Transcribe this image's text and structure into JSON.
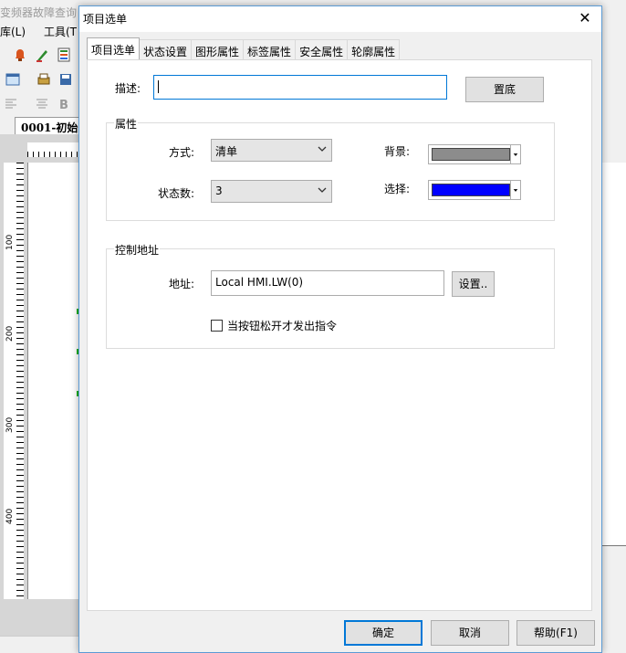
{
  "background_app": {
    "title": "变频器故障查询",
    "menu": {
      "lib": "库(L)",
      "tools": "工具(T"
    },
    "doc_tab": "0001-初始",
    "ruler_marks": [
      "100",
      "200",
      "300",
      "400"
    ]
  },
  "dialog": {
    "title": "项目选单",
    "close_glyph": "✕",
    "tabs": [
      "项目选单",
      "状态设置",
      "图形属性",
      "标签属性",
      "安全属性",
      "轮廓属性"
    ],
    "active_tab": 0,
    "description": {
      "label": "描述:",
      "value": ""
    },
    "bottom_button": "置底",
    "properties": {
      "group_label": "属性",
      "mode": {
        "label": "方式:",
        "value": "清单"
      },
      "states": {
        "label": "状态数:",
        "value": "3"
      },
      "background": {
        "label": "背景:",
        "color": "#8c8c8c"
      },
      "selection": {
        "label": "选择:",
        "color": "#0000ff"
      }
    },
    "control_address": {
      "group_label": "控制地址",
      "address": {
        "label": "地址:",
        "value": "Local HMI.LW(0)"
      },
      "settings_button": "设置..",
      "checkbox": {
        "label": "当按钮松开才发出指令",
        "checked": false
      }
    },
    "footer": {
      "ok": "确定",
      "cancel": "取消",
      "help": "帮助(F1)"
    }
  }
}
